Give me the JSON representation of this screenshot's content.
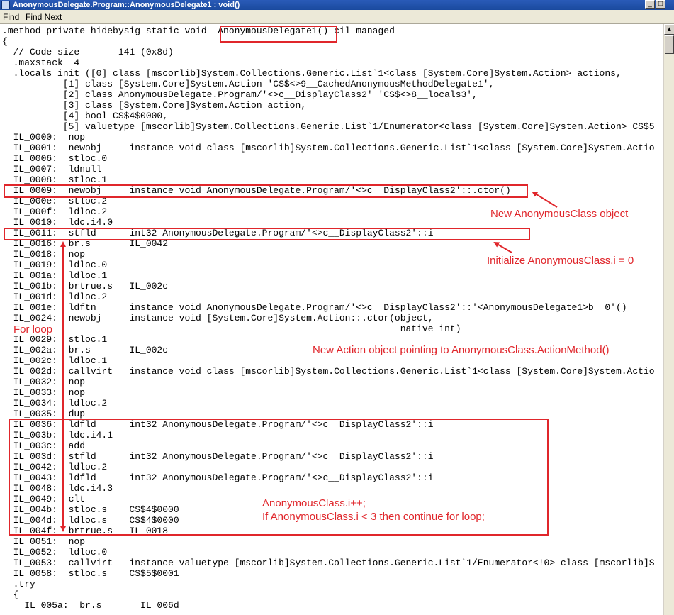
{
  "window": {
    "title": "AnonymousDelegate.Program::AnonymousDelegate1 : void()",
    "min_glyph": "_",
    "max_glyph": "□"
  },
  "menu": {
    "items": [
      "Find",
      "Find Next"
    ]
  },
  "code_lines": [
    ".method private hidebysig static void  AnonymousDelegate1() cil managed",
    "{",
    "  // Code size       141 (0x8d)",
    "  .maxstack  4",
    "  .locals init ([0] class [mscorlib]System.Collections.Generic.List`1<class [System.Core]System.Action> actions,",
    "           [1] class [System.Core]System.Action 'CS$<>9__CachedAnonymousMethodDelegate1',",
    "           [2] class AnonymousDelegate.Program/'<>c__DisplayClass2' 'CS$<>8__locals3',",
    "           [3] class [System.Core]System.Action action,",
    "           [4] bool CS$4$0000,",
    "           [5] valuetype [mscorlib]System.Collections.Generic.List`1/Enumerator<class [System.Core]System.Action> CS$5",
    "  IL_0000:  nop",
    "  IL_0001:  newobj     instance void class [mscorlib]System.Collections.Generic.List`1<class [System.Core]System.Actio",
    "  IL_0006:  stloc.0",
    "  IL_0007:  ldnull",
    "  IL_0008:  stloc.1",
    "  IL_0009:  newobj     instance void AnonymousDelegate.Program/'<>c__DisplayClass2'::.ctor()",
    "  IL_000e:  stloc.2",
    "  IL_000f:  ldloc.2",
    "  IL_0010:  ldc.i4.0",
    "  IL_0011:  stfld      int32 AnonymousDelegate.Program/'<>c__DisplayClass2'::i",
    "  IL_0016:  br.s       IL_0042",
    "  IL_0018:  nop",
    "  IL_0019:  ldloc.0",
    "  IL_001a:  ldloc.1",
    "  IL_001b:  brtrue.s   IL_002c",
    "  IL_001d:  ldloc.2",
    "  IL_001e:  ldftn      instance void AnonymousDelegate.Program/'<>c__DisplayClass2'::'<AnonymousDelegate1>b__0'()",
    "  IL_0024:  newobj     instance void [System.Core]System.Action::.ctor(object,",
    "                                                                        native int)",
    "  IL_0029:  stloc.1",
    "  IL_002a:  br.s       IL_002c",
    "  IL_002c:  ldloc.1",
    "  IL_002d:  callvirt   instance void class [mscorlib]System.Collections.Generic.List`1<class [System.Core]System.Actio",
    "  IL_0032:  nop",
    "  IL_0033:  nop",
    "  IL_0034:  ldloc.2",
    "  IL_0035:  dup",
    "  IL_0036:  ldfld      int32 AnonymousDelegate.Program/'<>c__DisplayClass2'::i",
    "  IL_003b:  ldc.i4.1",
    "  IL_003c:  add",
    "  IL_003d:  stfld      int32 AnonymousDelegate.Program/'<>c__DisplayClass2'::i",
    "  IL_0042:  ldloc.2",
    "  IL_0043:  ldfld      int32 AnonymousDelegate.Program/'<>c__DisplayClass2'::i",
    "  IL_0048:  ldc.i4.3",
    "  IL_0049:  clt",
    "  IL_004b:  stloc.s    CS$4$0000",
    "  IL_004d:  ldloc.s    CS$4$0000",
    "  IL_004f:  brtrue.s   IL_0018",
    "  IL_0051:  nop",
    "  IL_0052:  ldloc.0",
    "  IL_0053:  callvirt   instance valuetype [mscorlib]System.Collections.Generic.List`1/Enumerator<!0> class [mscorlib]S",
    "  IL_0058:  stloc.s    CS$5$0001",
    "  .try",
    "  {",
    "    IL_005a:  br.s       IL_006d"
  ],
  "annotations": {
    "ctor": "New AnonymousClass object",
    "init": "Initialize AnonymousClass.i = 0",
    "loop": "For loop",
    "action": "New Action object pointing to AnonymousClass.ActionMethod()",
    "incr_1": "AnonymousClass.i++;",
    "incr_2": "If AnonymousClass.i < 3 then continue for loop;"
  },
  "accent_color": "#e0262b"
}
